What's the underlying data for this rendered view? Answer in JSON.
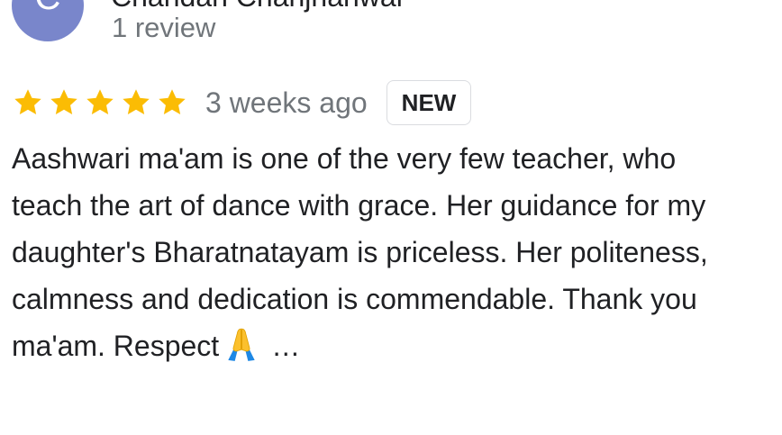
{
  "reviewer": {
    "avatar_letter": "C",
    "name": "Chandan Chanjhanwal",
    "review_count": "1 review",
    "avatar_color": "#7986cb"
  },
  "review": {
    "rating": 5,
    "max_rating": 5,
    "time_ago": "3 weeks ago",
    "badge": "NEW",
    "star_color": "#fbbc04",
    "text_lines": [
      "Aashwari ma'am is one of the very few teacher, who",
      "teach the art of dance with grace. Her guidance for my",
      "daughter's Bharatnatayam is priceless. Her politeness,",
      "calmness and dedication is commendable. Thank you",
      "ma'am. Respect"
    ],
    "emoji_icon": "folded-hands-icon",
    "ellipsis": "…"
  }
}
